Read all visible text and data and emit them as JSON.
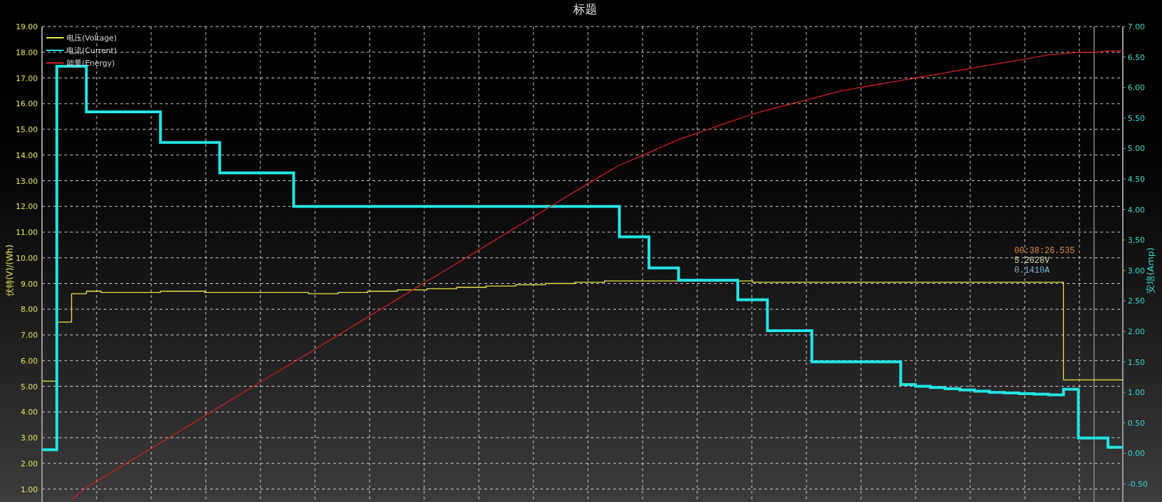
{
  "title": "标题",
  "chart": {
    "legend": [
      {
        "label": "电压(Voltage)",
        "color": "#e8e84a"
      },
      {
        "label": "电流(Current)",
        "color": "#22e5e5"
      },
      {
        "label": "能量(Energy)",
        "color": "#d42020"
      }
    ],
    "left_axis": {
      "label": "伏特(V)/(Wh)",
      "ticks": [
        "19.00",
        "18.00",
        "17.00",
        "16.00",
        "15.00",
        "14.00",
        "13.00",
        "12.00",
        "11.00",
        "10.00",
        "9.00",
        "8.00",
        "7.00",
        "6.00",
        "5.00",
        "4.00",
        "3.00",
        "2.00",
        "1.00"
      ]
    },
    "right_axis": {
      "label": "安培(Amp)",
      "ticks": [
        "7.00",
        "6.50",
        "6.00",
        "5.50",
        "5.00",
        "4.50",
        "4.00",
        "3.50",
        "3.00",
        "2.50",
        "2.00",
        "1.50",
        "1.00",
        "0.50",
        "0.00",
        "-0.50"
      ]
    },
    "cursor_readout": {
      "time": "00:38:26.535",
      "voltage": "5.2628V",
      "current": "0.1410A"
    }
  }
}
